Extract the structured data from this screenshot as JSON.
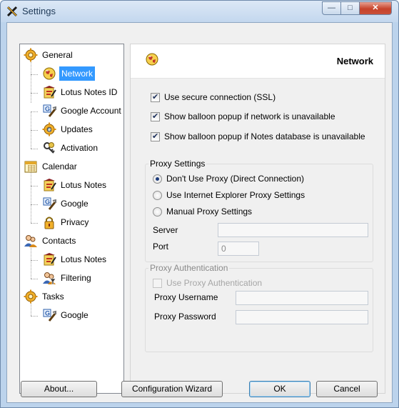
{
  "window": {
    "title": "Settings",
    "min_glyph": "—",
    "max_glyph": "□",
    "close_glyph": "✕"
  },
  "tree": {
    "general": "General",
    "network": "Network",
    "lotus_notes_id": "Lotus Notes ID",
    "google_account": "Google Account",
    "updates": "Updates",
    "activation": "Activation",
    "calendar": "Calendar",
    "calendar_lotus_notes": "Lotus Notes",
    "calendar_google": "Google",
    "privacy": "Privacy",
    "contacts": "Contacts",
    "contacts_lotus_notes": "Lotus Notes",
    "filtering": "Filtering",
    "tasks": "Tasks",
    "tasks_google": "Google"
  },
  "panel": {
    "title": "Network",
    "use_ssl": "Use secure connection (SSL)",
    "balloon_network": "Show balloon popup if network is unavailable",
    "balloon_notes_db": "Show balloon popup if Notes database is unavailable",
    "proxy_settings": {
      "label": "Proxy Settings",
      "no_proxy": "Don't Use Proxy (Direct Connection)",
      "ie_proxy": "Use Internet Explorer Proxy Settings",
      "manual_proxy": "Manual Proxy Settings",
      "server_label": "Server",
      "server_value": "",
      "port_label": "Port",
      "port_value": "0"
    },
    "proxy_auth": {
      "label": "Proxy Authentication",
      "use_auth": "Use Proxy Authentication",
      "username_label": "Proxy Username",
      "username_value": "",
      "password_label": "Proxy Password",
      "password_value": ""
    }
  },
  "buttons": {
    "about": "About...",
    "wizard": "Configuration Wizard",
    "ok": "OK",
    "cancel": "Cancel"
  }
}
